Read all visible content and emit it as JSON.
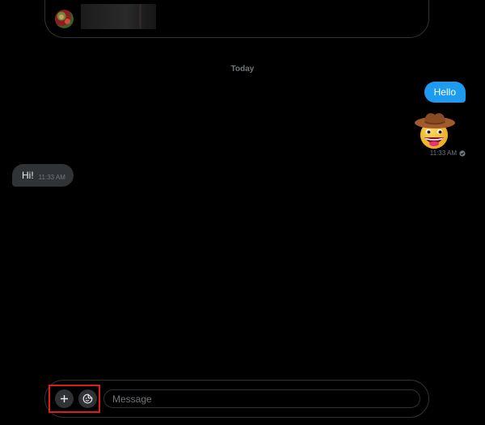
{
  "colors": {
    "background": "#000000",
    "accent": "#1d9bf0",
    "received_bubble": "#2f3336",
    "muted_text": "#71767b",
    "highlight": "#e01b1b"
  },
  "header": {
    "avatar_icon": "avatar-image",
    "name_redacted": true
  },
  "thread": {
    "date_divider": "Today",
    "messages": [
      {
        "direction": "sent",
        "text": "Hello"
      },
      {
        "direction": "sent",
        "emoji": "cowboy-hat-face-emoji",
        "time": "11:33 AM",
        "status_icon": "check-circle-icon"
      },
      {
        "direction": "received",
        "text": "Hi!",
        "time": "11:33 AM"
      }
    ]
  },
  "composer": {
    "add_button_icon": "plus-icon",
    "sticker_button_icon": "sticker-icon",
    "placeholder": "Message"
  }
}
